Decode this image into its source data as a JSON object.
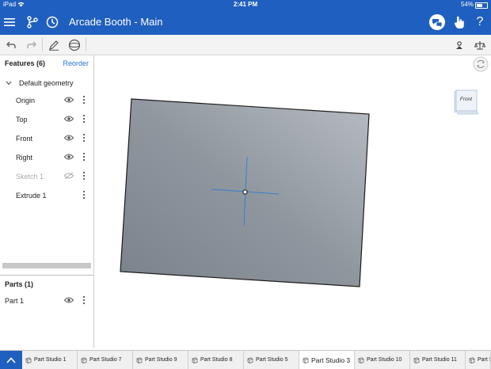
{
  "status_bar": {
    "device": "iPad",
    "time": "2:41 PM",
    "battery": "54%",
    "battery_level": 0.54
  },
  "header": {
    "doc_name": "Arcade Booth",
    "separator": " - ",
    "workspace": "Main",
    "icons": [
      "menu-icon",
      "branch-icon",
      "history-icon",
      "chat-icon",
      "touch-icon",
      "help-icon"
    ]
  },
  "toolbar": {
    "icons": [
      "undo-icon",
      "redo-icon",
      "sketch-icon",
      "plane-icon",
      "mate-connector-icon",
      "measure-icon"
    ]
  },
  "features": {
    "title": "Features (6)",
    "reorder_label": "Reorder",
    "group_label": "Default geometry",
    "items": [
      {
        "label": "Origin",
        "visible": true
      },
      {
        "label": "Top",
        "visible": true
      },
      {
        "label": "Front",
        "visible": true
      },
      {
        "label": "Right",
        "visible": true
      },
      {
        "label": "Sketch 1",
        "visible": false
      },
      {
        "label": "Extrude 1",
        "visible": null
      }
    ]
  },
  "parts": {
    "title": "Parts (1)",
    "items": [
      {
        "label": "Part 1",
        "visible": true
      }
    ]
  },
  "view_cube": {
    "label": "Front"
  },
  "tabs": [
    {
      "label": "Part Studio 1",
      "active": false
    },
    {
      "label": "Part Studio 7",
      "active": false
    },
    {
      "label": "Part Studio 9",
      "active": false
    },
    {
      "label": "Part Studio 8",
      "active": false
    },
    {
      "label": "Part Studio 5",
      "active": false
    },
    {
      "label": "Part Studio 3",
      "active": true
    },
    {
      "label": "Part Studio 10",
      "active": false
    },
    {
      "label": "Part Studio 11",
      "active": false
    },
    {
      "label": "Part S",
      "active": false
    }
  ],
  "colors": {
    "brand_blue": "#1f5fbf",
    "link_blue": "#2a74d0",
    "plate_gray": "#8e96a0"
  }
}
